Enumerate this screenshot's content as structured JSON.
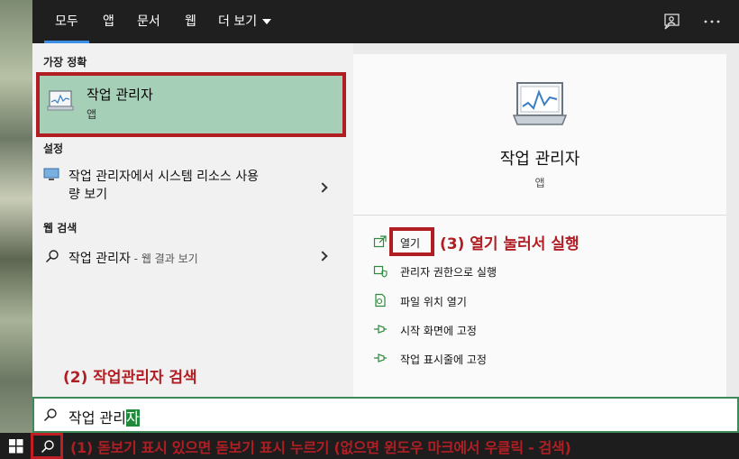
{
  "nav": {
    "tabs": [
      "모두",
      "앱",
      "문서",
      "웹",
      "더 보기"
    ],
    "active_index": 0
  },
  "left": {
    "best_match_header": "가장 정확",
    "best_match": {
      "title": "작업 관리자",
      "subtitle": "앱"
    },
    "settings_header": "설정",
    "settings_item": {
      "bold": "작업 관리자",
      "rest": "에서 시스템 리소스 사용",
      "line2": "량 보기"
    },
    "web_header": "웹 검색",
    "web_item": {
      "text": "작업 관리자",
      "suffix": " - 웹 결과 보기"
    }
  },
  "right": {
    "title": "작업 관리자",
    "subtitle": "앱",
    "actions": [
      "열기",
      "관리자 권한으로 실행",
      "파일 위치 열기",
      "시작 화면에 고정",
      "작업 표시줄에 고정"
    ]
  },
  "annotations": {
    "step1": "(1) 돋보기 표시 있으면 돋보기 표시 누르기 (없으면 윈도우 마크에서 우클릭 - 검색)",
    "step2": "(2) 작업관리자 검색",
    "step3": "(3) 열기 눌러서 실행",
    "color": "#b01e24"
  },
  "search": {
    "query_plain": "작업 관리",
    "query_selected": "자"
  },
  "colors": {
    "nav_bg": "#1f1f1f",
    "accent": "#3a8ee6",
    "best_match_bg": "#a6cfb8",
    "search_border": "#3b8a58"
  }
}
